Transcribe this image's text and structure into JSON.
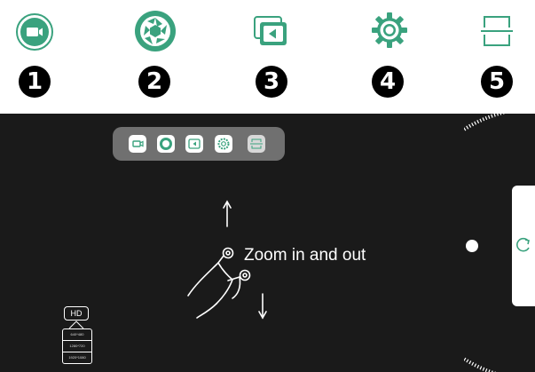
{
  "legend": {
    "items": [
      {
        "number": "1",
        "icon": "video-camera-icon"
      },
      {
        "number": "2",
        "icon": "camera-shutter-icon"
      },
      {
        "number": "3",
        "icon": "gallery-icon"
      },
      {
        "number": "4",
        "icon": "settings-gear-icon"
      },
      {
        "number": "5",
        "icon": "crop-frame-icon"
      }
    ]
  },
  "camera_screen": {
    "toolbar_icons": [
      "video-camera-icon",
      "camera-shutter-icon",
      "gallery-icon",
      "settings-gear-icon",
      "crop-frame-icon"
    ],
    "gesture_hint": "Zoom in and out",
    "hd_label": "HD",
    "resolutions": [
      "640*480",
      "1280*720",
      "1920*1080"
    ],
    "side_button_icon": "rotate-camera-icon"
  },
  "colors": {
    "accent": "#3aa27e",
    "screen_background": "#1a1a1a",
    "toolbar_background": "#707070",
    "badge": "#000000"
  }
}
